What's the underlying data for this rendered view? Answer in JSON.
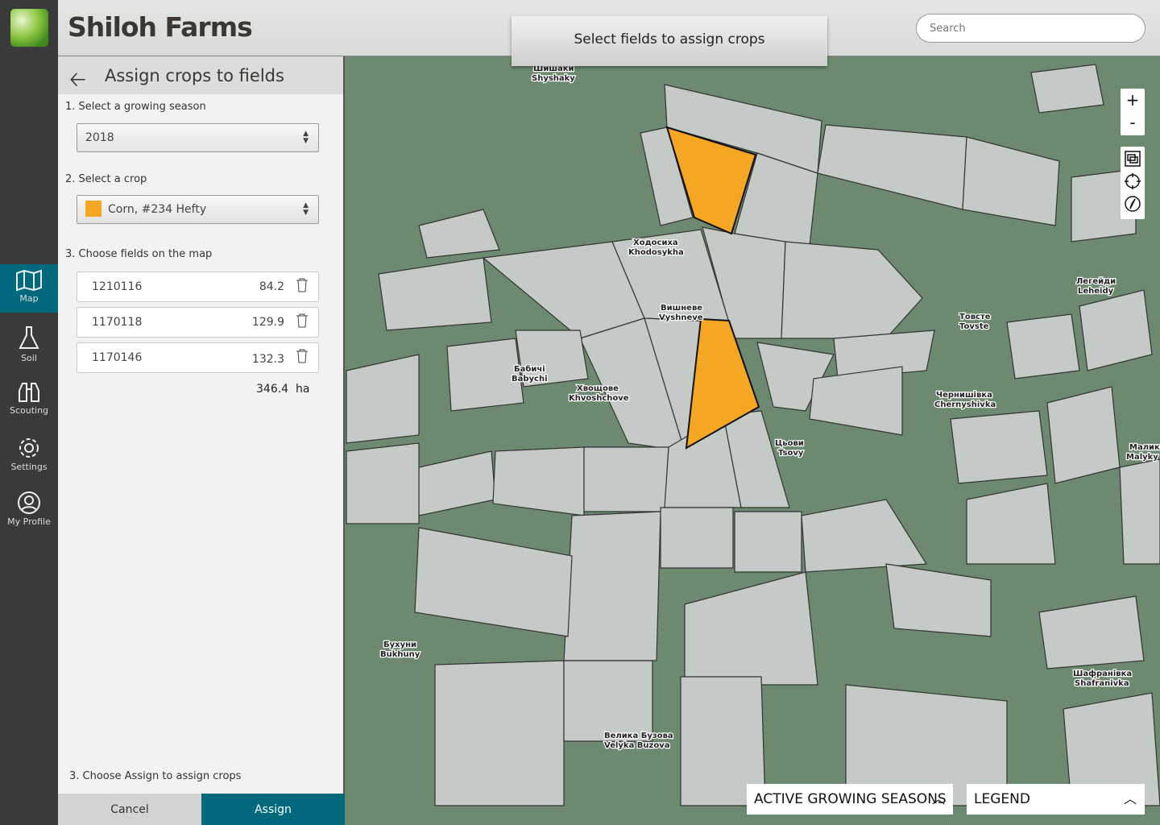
{
  "app": {
    "title": "Shiloh Farms"
  },
  "nav": [
    {
      "label": "Map",
      "icon": "map-icon",
      "active": true
    },
    {
      "label": "Soil",
      "icon": "flask-icon"
    },
    {
      "label": "Scouting",
      "icon": "binoculars-icon"
    },
    {
      "label": "Settings",
      "icon": "gear-icon"
    },
    {
      "label": "My Profile",
      "icon": "user-icon"
    }
  ],
  "banner": "Select fields to assign crops",
  "search": {
    "placeholder": "Search"
  },
  "panel": {
    "title": "Assign crops to fields",
    "step1": "1. Select a growing season",
    "season": "2018",
    "step2": "2. Select a crop",
    "crop": "Corn, #234 Hefty",
    "crop_color": "#f5a623",
    "step3": "3. Choose fields on the map",
    "fields": [
      {
        "id": "1210116",
        "ha": "84.2"
      },
      {
        "id": "1170118",
        "ha": "129.9"
      },
      {
        "id": "1170146",
        "ha": "132.3"
      }
    ],
    "total": "346.4",
    "unit": "ha",
    "step4": "3. Choose Assign to assign crops",
    "cancel": "Cancel",
    "assign": "Assign"
  },
  "map": {
    "labels": [
      [
        "Шишаки",
        "Shyshaky"
      ],
      [
        "Ходосиха",
        "Khodosykha"
      ],
      [
        "Вишневе",
        "Vyshneve"
      ],
      [
        "Бабичі",
        "Babychi"
      ],
      [
        "Хвощове",
        "Khvoshchove"
      ],
      [
        "Цьови",
        "Tsovy"
      ],
      [
        "Товсте",
        "Tovste"
      ],
      [
        "Чернишівка",
        "Chernyshivka"
      ],
      [
        "Легейди",
        "Leheidy"
      ],
      [
        "Малики",
        "Malyky"
      ],
      [
        "Бухуни",
        "Bukhuny"
      ],
      [
        "Велика Бузова",
        "Velyka Buzova"
      ],
      [
        "Шафранівка",
        "Shafranivka"
      ]
    ],
    "zoom_in": "+",
    "zoom_out": "-"
  },
  "bottom": {
    "seasons": "ACTIVE GROWING SEASONS",
    "legend": "LEGEND"
  },
  "colors": {
    "accent": "#006a7c",
    "selected_field": "#f5a623"
  }
}
